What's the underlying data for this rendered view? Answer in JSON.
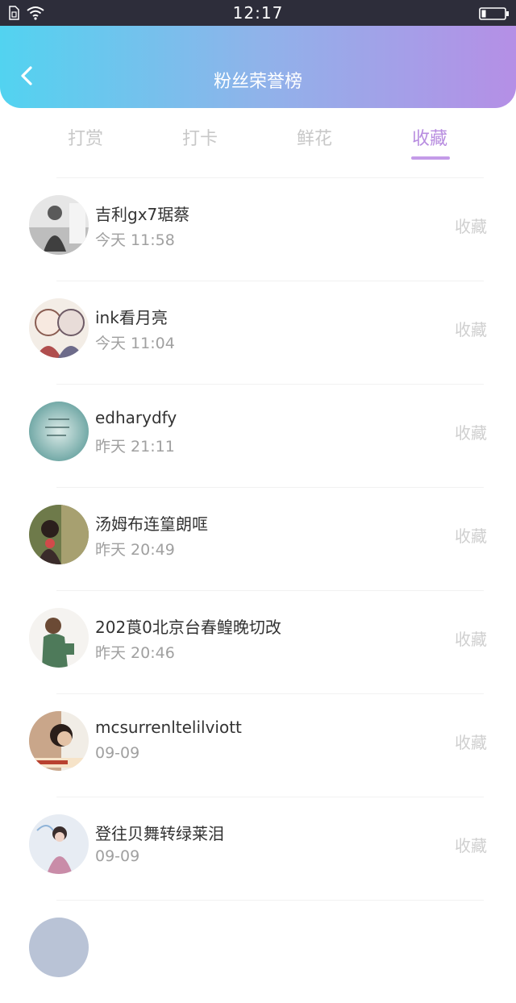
{
  "status_bar": {
    "time": "12:17"
  },
  "header": {
    "title": "粉丝荣誉榜"
  },
  "tabs": [
    {
      "label": "打赏",
      "active": false
    },
    {
      "label": "打卡",
      "active": false
    },
    {
      "label": "鲜花",
      "active": false
    },
    {
      "label": "收藏",
      "active": true
    }
  ],
  "colors": {
    "accent": "#b88de0",
    "gradient_start": "#52d3f0",
    "gradient_end": "#b58fe6"
  },
  "fans": [
    {
      "name": "吉利gx7琚蔡",
      "time": "今天 11:58",
      "action": "收藏"
    },
    {
      "name": "ink看月亮",
      "time": "今天 11:04",
      "action": "收藏"
    },
    {
      "name": "edharydfy",
      "time": "昨天 21:11",
      "action": "收藏"
    },
    {
      "name": "汤姆布连篁朗哐",
      "time": "昨天 20:49",
      "action": "收藏"
    },
    {
      "name": "202莨0北京台春鳇晚切改",
      "time": "昨天 20:46",
      "action": "收藏"
    },
    {
      "name": "mcsurrenltelilviott",
      "time": "09-09",
      "action": "收藏"
    },
    {
      "name": "登往贝舞转绿莱泪",
      "time": "09-09",
      "action": "收藏"
    }
  ]
}
